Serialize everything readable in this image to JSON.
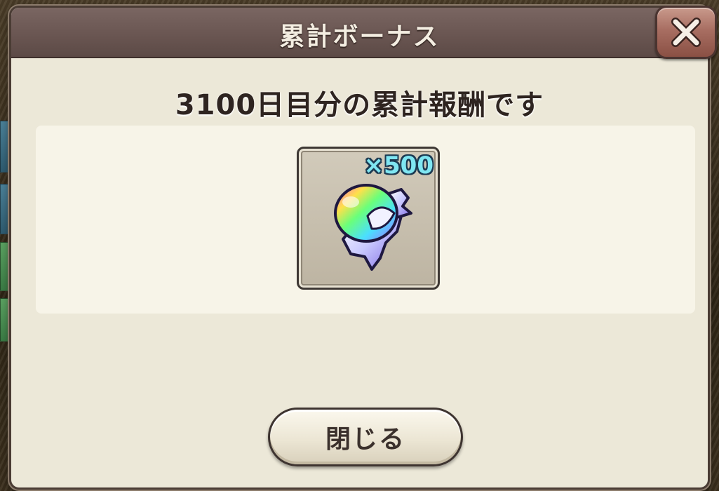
{
  "dialog": {
    "title": "累計ボーナス",
    "subtitle": "3100日目分の累計報酬です",
    "close_icon": "close-x-icon",
    "reward": {
      "icon": "rainbow-orb-crystal-icon",
      "quantity": "×500"
    },
    "close_button_label": "閉じる"
  },
  "colors": {
    "header": "#6a5652",
    "panel": "#ece8d8",
    "reward_area": "#f7f4e8",
    "quantity_text": "#7fe6f2",
    "close_button": "#a86e62"
  }
}
